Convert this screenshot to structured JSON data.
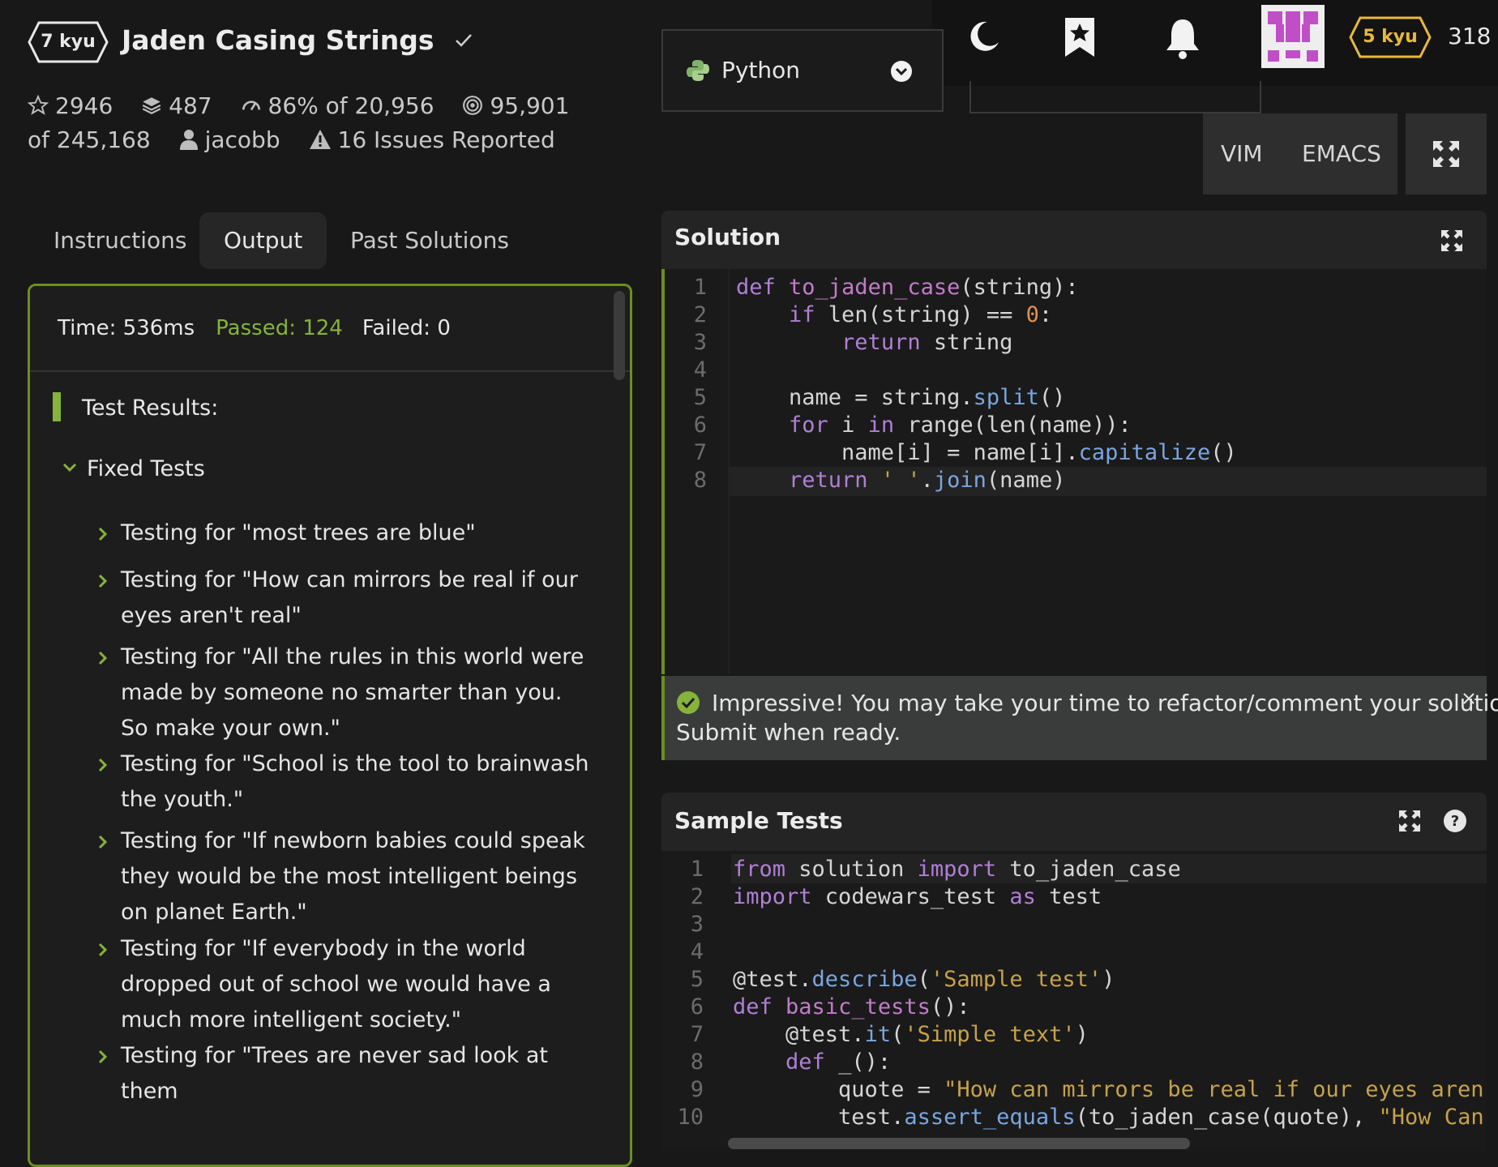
{
  "kata": {
    "rank": "7 kyu",
    "title": "Jaden Casing Strings",
    "stars": "2946",
    "collections": "487",
    "satisfaction": "86% of 20,956",
    "completions": "95,901 of 245,168",
    "author": "jacobb",
    "issues": "16 Issues Reported"
  },
  "tabs": [
    "Instructions",
    "Output",
    "Past Solutions"
  ],
  "output": {
    "time": "Time: 536ms",
    "passed": "Passed: 124",
    "failed": "Failed: 0",
    "results_heading": "Test Results:",
    "group": "Fixed Tests",
    "tests": [
      "Testing for \"most trees are blue\"",
      "Testing for \"How can mirrors be real if our eyes aren't real\"",
      "Testing for \"All the rules in this world were made by someone no smarter than you. So make your own.\"",
      "Testing for \"School is the tool to brainwash the youth.\"",
      "Testing for \"If newborn babies could speak they would be the most intelligent beings on planet Earth.\"",
      "Testing for \"If everybody in the world dropped out of school we would have a much more intelligent society.\"",
      "Testing for \"Trees are never sad look at them"
    ]
  },
  "editor": {
    "language": "Python",
    "vim": "VIM",
    "emacs": "EMACS"
  },
  "user": {
    "rank": "5 kyu",
    "honor": "318"
  },
  "solution": {
    "title": "Solution",
    "lines": [
      "1",
      "2",
      "3",
      "4",
      "5",
      "6",
      "7",
      "8"
    ],
    "banner_line1": "Impressive! You may take your time to refactor/comment your solution.",
    "banner_line2": "Submit when ready."
  },
  "sample_tests": {
    "title": "Sample Tests",
    "lines": [
      "1",
      "2",
      "3",
      "4",
      "5",
      "6",
      "7",
      "8",
      "9",
      "10"
    ]
  },
  "icons": [
    "moon-icon",
    "bookmark-star-icon",
    "bell-icon",
    "avatar",
    "python-icon",
    "chevron-down-icon",
    "fullscreen-icon",
    "help-icon",
    "close-icon",
    "check-circle-icon"
  ],
  "colors": {
    "accent_green": "#86b33a",
    "border_green": "#6b8f1f",
    "rank_gold": "#e8b93b",
    "avatar_pink": "#c04fc7"
  }
}
